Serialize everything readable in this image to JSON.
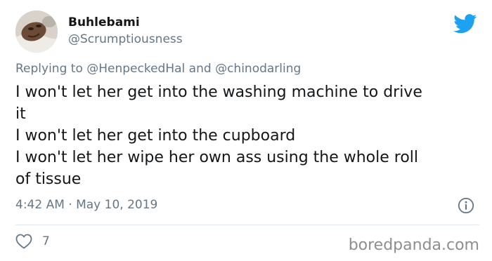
{
  "user": {
    "display_name": "Buhlebami",
    "handle": "@Scrumptiousness"
  },
  "reply": {
    "prefix": "Replying to ",
    "mention_1": "@HenpeckedHal",
    "joiner": " and ",
    "mention_2": "@chinodarling"
  },
  "tweet": {
    "lines": [
      "I won't let her get into the washing machine to drive",
      "it",
      "I won't let her get into the cupboard",
      "I won't let her wipe her own ass using the whole roll",
      "of tissue"
    ]
  },
  "timestamp": "4:42 AM · May 10, 2019",
  "likes": {
    "count": "7",
    "icon": "heart-icon"
  },
  "icons": {
    "brand": "twitter-bird-icon",
    "info": "info-icon"
  },
  "watermark": "boredpanda.com",
  "colors": {
    "twitter_blue": "#1da1f2",
    "secondary_text": "#657786",
    "primary_text": "#14171a",
    "divider": "#e1e8ed"
  }
}
